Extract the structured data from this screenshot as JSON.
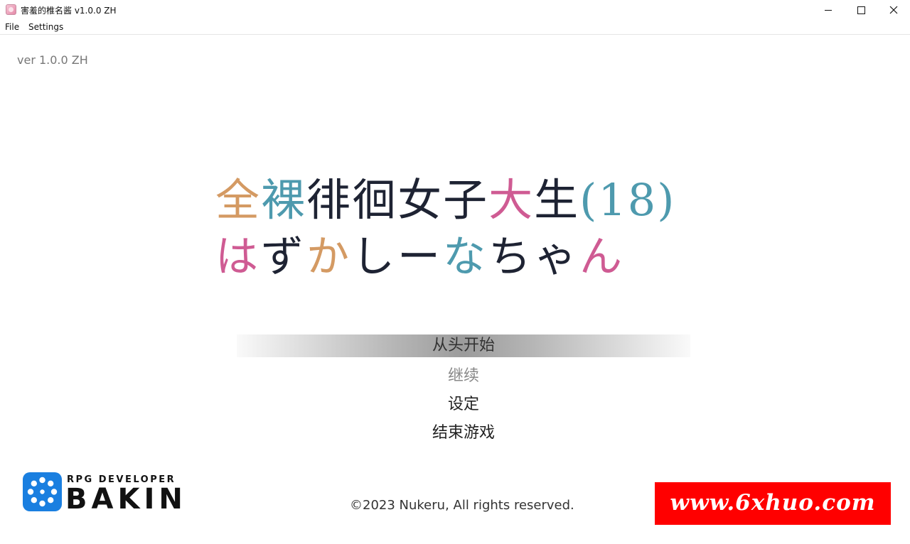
{
  "window": {
    "title": "害羞的椎名酱 v1.0.0 ZH",
    "minimize_label": "—",
    "close_label": "✕"
  },
  "menubar": {
    "file": "File",
    "settings": "Settings"
  },
  "game": {
    "version": "ver 1.0.0 ZH",
    "title_line1": [
      "全",
      "裸",
      "徘",
      "徊",
      "女",
      "子",
      "大",
      "生",
      "(18)"
    ],
    "title_line2": [
      "は",
      "ず",
      "か",
      "し",
      "ー",
      "な",
      "ち",
      "ゃ",
      "ん"
    ],
    "menu": [
      {
        "label": "从头开始",
        "state": "selected"
      },
      {
        "label": "继续",
        "state": "disabled"
      },
      {
        "label": "设定",
        "state": "normal"
      },
      {
        "label": "结束游戏",
        "state": "normal"
      }
    ],
    "engine_logo": {
      "subtitle": "RPG DEVELOPER",
      "name": "BAKIN"
    },
    "copyright": "©2023 Nukeru, All rights reserved.",
    "watermark": "www.6xhuo.com"
  },
  "colors": {
    "title_dark": "#1e2333",
    "accent_orange": "#d49a63",
    "accent_teal": "#4e9aae",
    "accent_pink": "#cf5b93",
    "bakin_blue": "#1a7fe0",
    "watermark_red": "#ff0000"
  }
}
